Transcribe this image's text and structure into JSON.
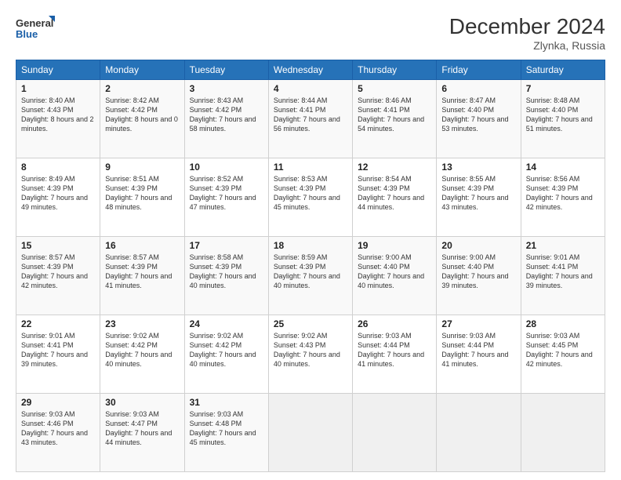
{
  "logo": {
    "line1": "General",
    "line2": "Blue"
  },
  "title": "December 2024",
  "location": "Zlynka, Russia",
  "days_header": [
    "Sunday",
    "Monday",
    "Tuesday",
    "Wednesday",
    "Thursday",
    "Friday",
    "Saturday"
  ],
  "weeks": [
    [
      {
        "day": "1",
        "sunrise": "8:40 AM",
        "sunset": "4:43 PM",
        "daylight": "8 hours and 2 minutes"
      },
      {
        "day": "2",
        "sunrise": "8:42 AM",
        "sunset": "4:42 PM",
        "daylight": "8 hours and 0 minutes"
      },
      {
        "day": "3",
        "sunrise": "8:43 AM",
        "sunset": "4:42 PM",
        "daylight": "7 hours and 58 minutes"
      },
      {
        "day": "4",
        "sunrise": "8:44 AM",
        "sunset": "4:41 PM",
        "daylight": "7 hours and 56 minutes"
      },
      {
        "day": "5",
        "sunrise": "8:46 AM",
        "sunset": "4:41 PM",
        "daylight": "7 hours and 54 minutes"
      },
      {
        "day": "6",
        "sunrise": "8:47 AM",
        "sunset": "4:40 PM",
        "daylight": "7 hours and 53 minutes"
      },
      {
        "day": "7",
        "sunrise": "8:48 AM",
        "sunset": "4:40 PM",
        "daylight": "7 hours and 51 minutes"
      }
    ],
    [
      {
        "day": "8",
        "sunrise": "8:49 AM",
        "sunset": "4:39 PM",
        "daylight": "7 hours and 49 minutes"
      },
      {
        "day": "9",
        "sunrise": "8:51 AM",
        "sunset": "4:39 PM",
        "daylight": "7 hours and 48 minutes"
      },
      {
        "day": "10",
        "sunrise": "8:52 AM",
        "sunset": "4:39 PM",
        "daylight": "7 hours and 47 minutes"
      },
      {
        "day": "11",
        "sunrise": "8:53 AM",
        "sunset": "4:39 PM",
        "daylight": "7 hours and 45 minutes"
      },
      {
        "day": "12",
        "sunrise": "8:54 AM",
        "sunset": "4:39 PM",
        "daylight": "7 hours and 44 minutes"
      },
      {
        "day": "13",
        "sunrise": "8:55 AM",
        "sunset": "4:39 PM",
        "daylight": "7 hours and 43 minutes"
      },
      {
        "day": "14",
        "sunrise": "8:56 AM",
        "sunset": "4:39 PM",
        "daylight": "7 hours and 42 minutes"
      }
    ],
    [
      {
        "day": "15",
        "sunrise": "8:57 AM",
        "sunset": "4:39 PM",
        "daylight": "7 hours and 42 minutes"
      },
      {
        "day": "16",
        "sunrise": "8:57 AM",
        "sunset": "4:39 PM",
        "daylight": "7 hours and 41 minutes"
      },
      {
        "day": "17",
        "sunrise": "8:58 AM",
        "sunset": "4:39 PM",
        "daylight": "7 hours and 40 minutes"
      },
      {
        "day": "18",
        "sunrise": "8:59 AM",
        "sunset": "4:39 PM",
        "daylight": "7 hours and 40 minutes"
      },
      {
        "day": "19",
        "sunrise": "9:00 AM",
        "sunset": "4:40 PM",
        "daylight": "7 hours and 40 minutes"
      },
      {
        "day": "20",
        "sunrise": "9:00 AM",
        "sunset": "4:40 PM",
        "daylight": "7 hours and 39 minutes"
      },
      {
        "day": "21",
        "sunrise": "9:01 AM",
        "sunset": "4:41 PM",
        "daylight": "7 hours and 39 minutes"
      }
    ],
    [
      {
        "day": "22",
        "sunrise": "9:01 AM",
        "sunset": "4:41 PM",
        "daylight": "7 hours and 39 minutes"
      },
      {
        "day": "23",
        "sunrise": "9:02 AM",
        "sunset": "4:42 PM",
        "daylight": "7 hours and 40 minutes"
      },
      {
        "day": "24",
        "sunrise": "9:02 AM",
        "sunset": "4:42 PM",
        "daylight": "7 hours and 40 minutes"
      },
      {
        "day": "25",
        "sunrise": "9:02 AM",
        "sunset": "4:43 PM",
        "daylight": "7 hours and 40 minutes"
      },
      {
        "day": "26",
        "sunrise": "9:03 AM",
        "sunset": "4:44 PM",
        "daylight": "7 hours and 41 minutes"
      },
      {
        "day": "27",
        "sunrise": "9:03 AM",
        "sunset": "4:44 PM",
        "daylight": "7 hours and 41 minutes"
      },
      {
        "day": "28",
        "sunrise": "9:03 AM",
        "sunset": "4:45 PM",
        "daylight": "7 hours and 42 minutes"
      }
    ],
    [
      {
        "day": "29",
        "sunrise": "9:03 AM",
        "sunset": "4:46 PM",
        "daylight": "7 hours and 43 minutes"
      },
      {
        "day": "30",
        "sunrise": "9:03 AM",
        "sunset": "4:47 PM",
        "daylight": "7 hours and 44 minutes"
      },
      {
        "day": "31",
        "sunrise": "9:03 AM",
        "sunset": "4:48 PM",
        "daylight": "7 hours and 45 minutes"
      },
      null,
      null,
      null,
      null
    ]
  ],
  "labels": {
    "sunrise": "Sunrise:",
    "sunset": "Sunset:",
    "daylight": "Daylight:"
  }
}
